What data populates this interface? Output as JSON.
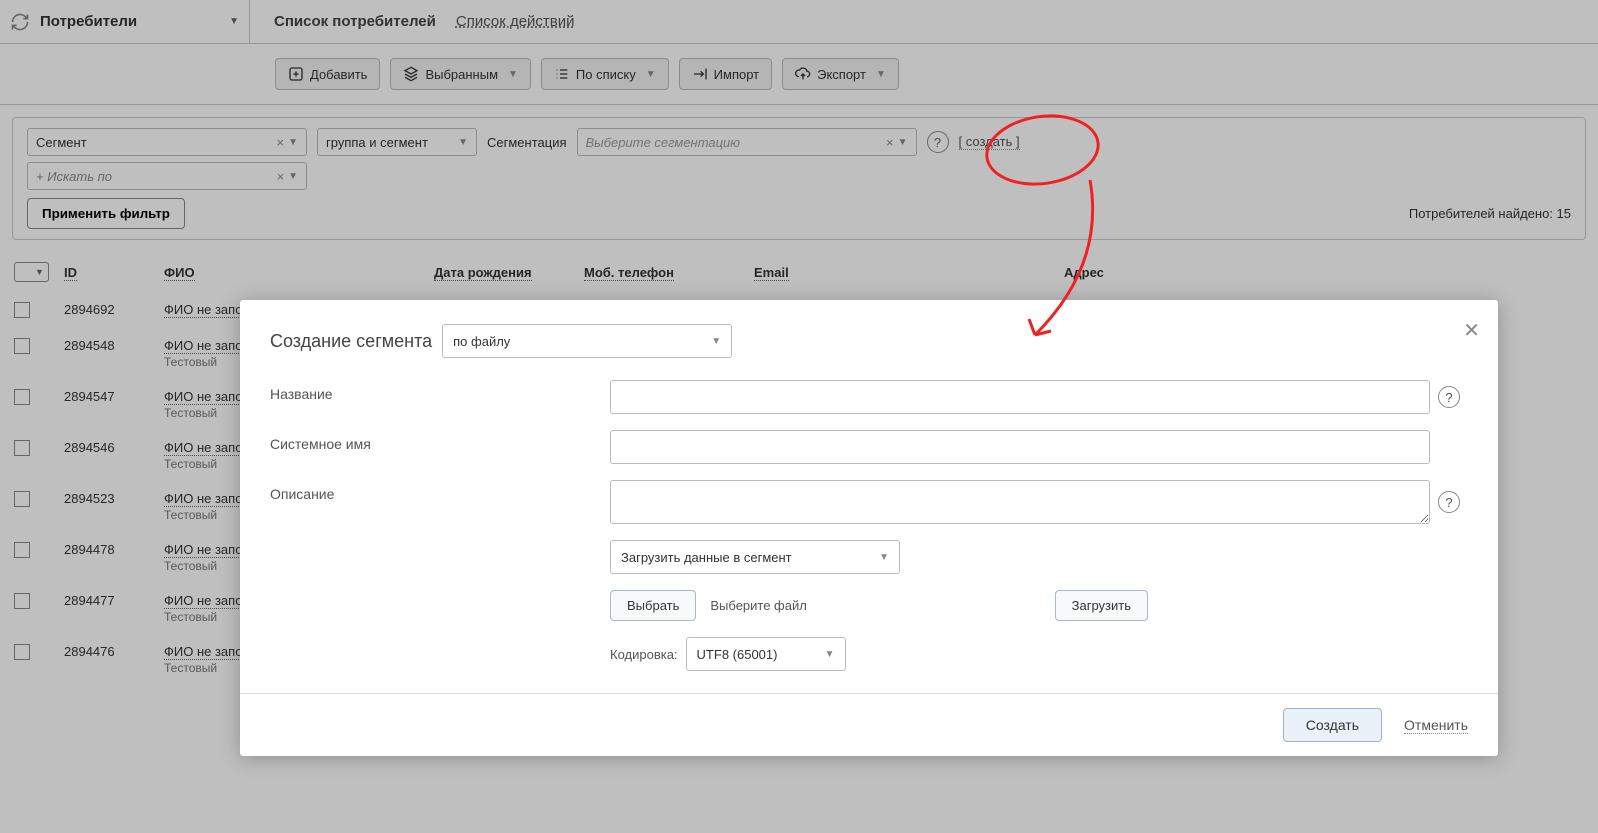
{
  "header": {
    "section": "Потребители",
    "tabs": [
      "Список потребителей",
      "Список действий"
    ]
  },
  "toolbar": {
    "add": "Добавить",
    "selected": "Выбранным",
    "by_list": "По списку",
    "import": "Импорт",
    "export": "Экспорт"
  },
  "filters": {
    "segment": "Сегмент",
    "group_segment": "группа и сегмент",
    "segmentation_label": "Сегментация",
    "segmentation_placeholder": "Выберите сегментацию",
    "create": "[ создать ]",
    "search_placeholder": "+ Искать по",
    "apply": "Применить фильтр",
    "count_label": "Потребителей найдено: 15"
  },
  "table": {
    "headers": {
      "id": "ID",
      "name": "ФИО",
      "dob": "Дата рождения",
      "phone": "Моб. телефон",
      "email": "Email",
      "addr": "Адрес"
    },
    "name_placeholder": "ФИО не заполнено",
    "sub": "Тестовый",
    "rows": [
      {
        "id": "2894692",
        "sub": ""
      },
      {
        "id": "2894548",
        "sub": "Тестовый"
      },
      {
        "id": "2894547",
        "sub": "Тестовый"
      },
      {
        "id": "2894546",
        "sub": "Тестовый"
      },
      {
        "id": "2894523",
        "sub": "Тестовый"
      },
      {
        "id": "2894478",
        "sub": "Тестовый"
      },
      {
        "id": "2894477",
        "sub": "Тестовый"
      },
      {
        "id": "2894476",
        "sub": "Тестовый"
      }
    ]
  },
  "modal": {
    "title": "Создание сегмента",
    "mode": "по файлу",
    "labels": {
      "name": "Название",
      "system_name": "Системное имя",
      "description": "Описание",
      "load_mode": "Загрузить данные в сегмент",
      "choose": "Выбрать",
      "choose_hint": "Выберите файл",
      "upload": "Загрузить",
      "encoding_label": "Кодировка:",
      "encoding_value": "UTF8 (65001)"
    },
    "footer": {
      "create": "Создать",
      "cancel": "Отменить"
    }
  }
}
